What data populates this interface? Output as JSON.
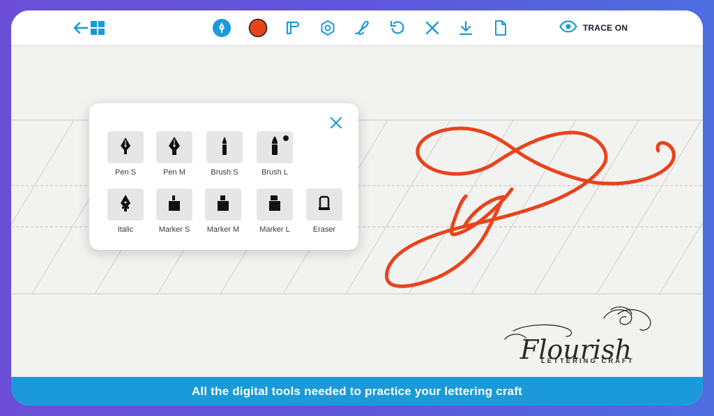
{
  "toolbar": {
    "buttons": [
      {
        "icon": "back-arrow-icon"
      },
      {
        "icon": "grid-menu-icon"
      },
      {
        "icon": "pen-tool-icon"
      },
      {
        "icon": "color-picker-icon",
        "color": "#e8431a"
      },
      {
        "icon": "paper-icon"
      },
      {
        "icon": "settings-icon"
      },
      {
        "icon": "letter-l-icon"
      },
      {
        "icon": "undo-icon"
      },
      {
        "icon": "clear-icon"
      },
      {
        "icon": "download-icon"
      },
      {
        "icon": "document-icon"
      }
    ],
    "trace": {
      "icon": "eye-icon",
      "label": "TRACE ON"
    }
  },
  "tool_popup": {
    "close_icon": "close-icon",
    "tools": [
      {
        "label": "Pen S",
        "icon": "pen-nib-icon"
      },
      {
        "label": "Pen M",
        "icon": "pen-nib-icon"
      },
      {
        "label": "Brush S",
        "icon": "brush-icon"
      },
      {
        "label": "Brush L",
        "icon": "brush-icon",
        "selected_dot": true
      },
      {
        "label": "Italic",
        "icon": "italic-nib-icon"
      },
      {
        "label": "Marker S",
        "icon": "marker-icon"
      },
      {
        "label": "Marker M",
        "icon": "marker-icon"
      },
      {
        "label": "Marker L",
        "icon": "marker-icon"
      },
      {
        "label": "Eraser",
        "icon": "eraser-icon"
      }
    ]
  },
  "logo": {
    "title": "Flourish",
    "subtitle": "LETTERING CRAFT"
  },
  "banner": {
    "text": "All the digital tools needed to practice your lettering craft"
  },
  "colors": {
    "accent": "#1a9ad9",
    "stroke": "#e8431a",
    "background_gradient": [
      "#6a4fd6",
      "#4e6ee0"
    ]
  }
}
